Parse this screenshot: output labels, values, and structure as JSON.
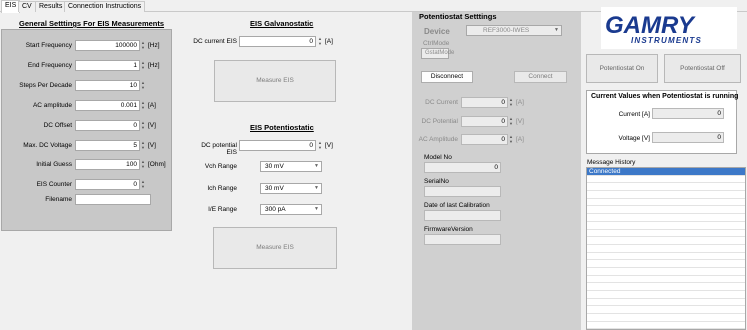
{
  "tabs": [
    {
      "label": "EIS",
      "active": true
    },
    {
      "label": "CV",
      "active": false
    },
    {
      "label": "Results",
      "active": false
    },
    {
      "label": "Connection Instructions",
      "active": false
    }
  ],
  "eis": {
    "title": "General Setttings For EIS Measurements",
    "fields": [
      {
        "label": "Start Frequency",
        "value": "100000",
        "unit": "[Hz]"
      },
      {
        "label": "End Frequency",
        "value": "1",
        "unit": "[Hz]"
      },
      {
        "label": "Steps Per Decade",
        "value": "10",
        "unit": ""
      },
      {
        "label": "AC amplitude",
        "value": "0.001",
        "unit": "[A]"
      },
      {
        "label": "DC Offset",
        "value": "0",
        "unit": "[V]"
      },
      {
        "label": "Max. DC Voltage",
        "value": "5",
        "unit": "[V]"
      },
      {
        "label": "Initial Guess",
        "value": "100",
        "unit": "[Ohm]"
      },
      {
        "label": "EIS Counter",
        "value": "0",
        "unit": ""
      }
    ],
    "filename_label": "Filename",
    "filename_value": ""
  },
  "galvano": {
    "title": "EIS Galvanostatic",
    "dc_current_label": "DC current EIS",
    "dc_current_value": "0",
    "dc_current_unit": "[A]",
    "measure_label": "Measure EIS"
  },
  "potentio": {
    "title": "EIS Potentiostatic",
    "dc_potential_label": "DC potential EIS",
    "dc_potential_value": "0",
    "dc_potential_unit": "[V]",
    "vch_label": "Vch Range",
    "vch_value": "30 mV",
    "ich_label": "Ich Range",
    "ich_value": "30 mV",
    "ie_label": "I/E Range",
    "ie_value": "300 pA",
    "measure_label": "Measure EIS"
  },
  "potentiostat": {
    "title": "Potentiostat Setttings",
    "device_label": "Device",
    "device_value": "REF3000-IWES",
    "ctrlmode_label": "CtrlMode",
    "ctrlmode_value": "GstatMode",
    "disconnect_label": "Disconnect",
    "connect_label": "Connect",
    "dc_current_label": "DC Current",
    "dc_current_value": "0",
    "dc_current_unit": "[A]",
    "dc_potential_label": "DC Potential",
    "dc_potential_value": "0",
    "dc_potential_unit": "[V]",
    "ac_amplitude_label": "AC Amplitude",
    "ac_amplitude_value": "0",
    "ac_amplitude_unit": "[A]",
    "model_label": "Model No",
    "model_value": "0",
    "serial_label": "SerialNo",
    "serial_value": "",
    "calibration_label": "Date of last Calibration",
    "calibration_value": "",
    "firmware_label": "FirmwareVersion",
    "firmware_value": ""
  },
  "brand": {
    "name": "GAMRY",
    "subtitle": "INSTRUMENTS",
    "color": "#1a3a8f"
  },
  "controls": {
    "pot_on_label": "Potentiostat On",
    "pot_off_label": "Potentiostat Off"
  },
  "current_values": {
    "title": "Current Values when Potentiostat is running",
    "current_label": "Current [A]",
    "current_value": "0",
    "voltage_label": "Voltage [V]",
    "voltage_value": "0"
  },
  "messages": {
    "title": "Message History",
    "items": [
      "Connected"
    ]
  },
  "colors": {
    "selection": "#3c78c8",
    "panel": "#c8c8c8"
  }
}
